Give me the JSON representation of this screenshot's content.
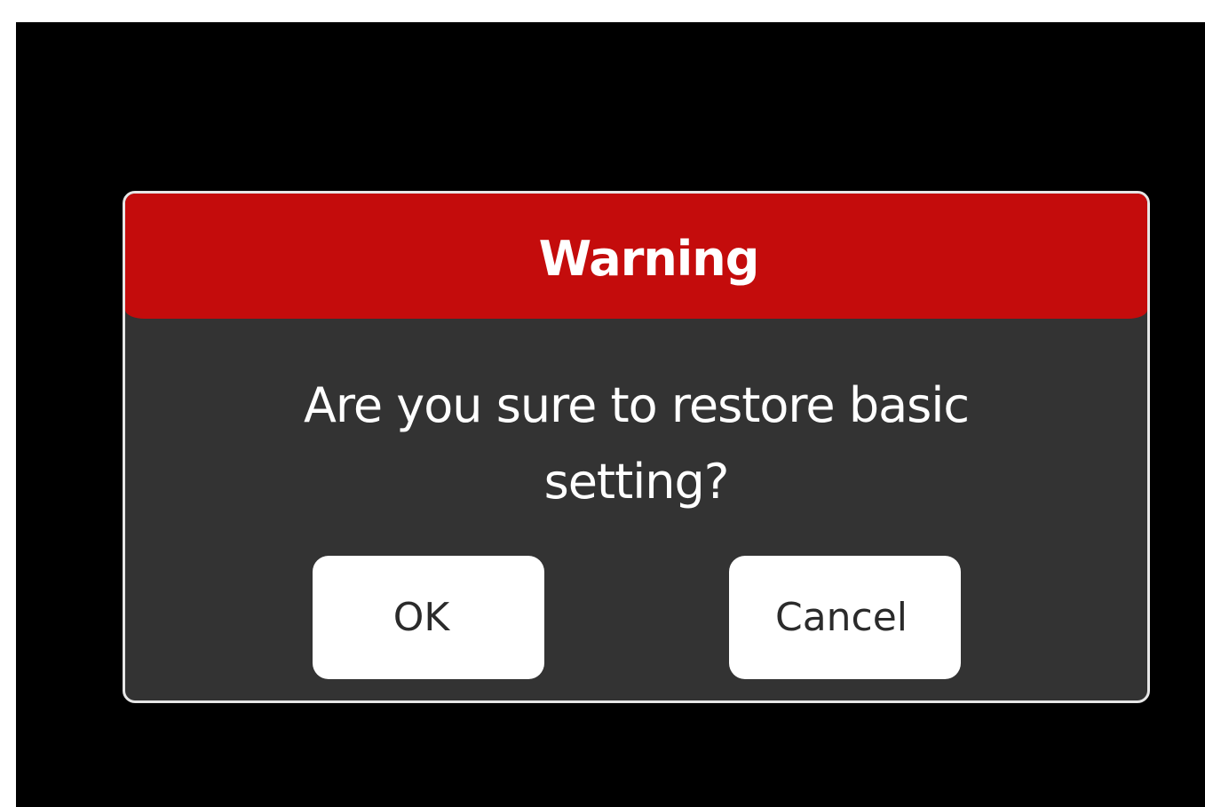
{
  "dialog": {
    "title": "Warning",
    "message": "Are you sure to restore basic setting?",
    "ok_label": "OK",
    "cancel_label": "Cancel"
  },
  "colors": {
    "header_background": "#c40c0c",
    "dialog_background": "#333333",
    "screen_background": "#000000",
    "button_background": "#ffffff"
  }
}
